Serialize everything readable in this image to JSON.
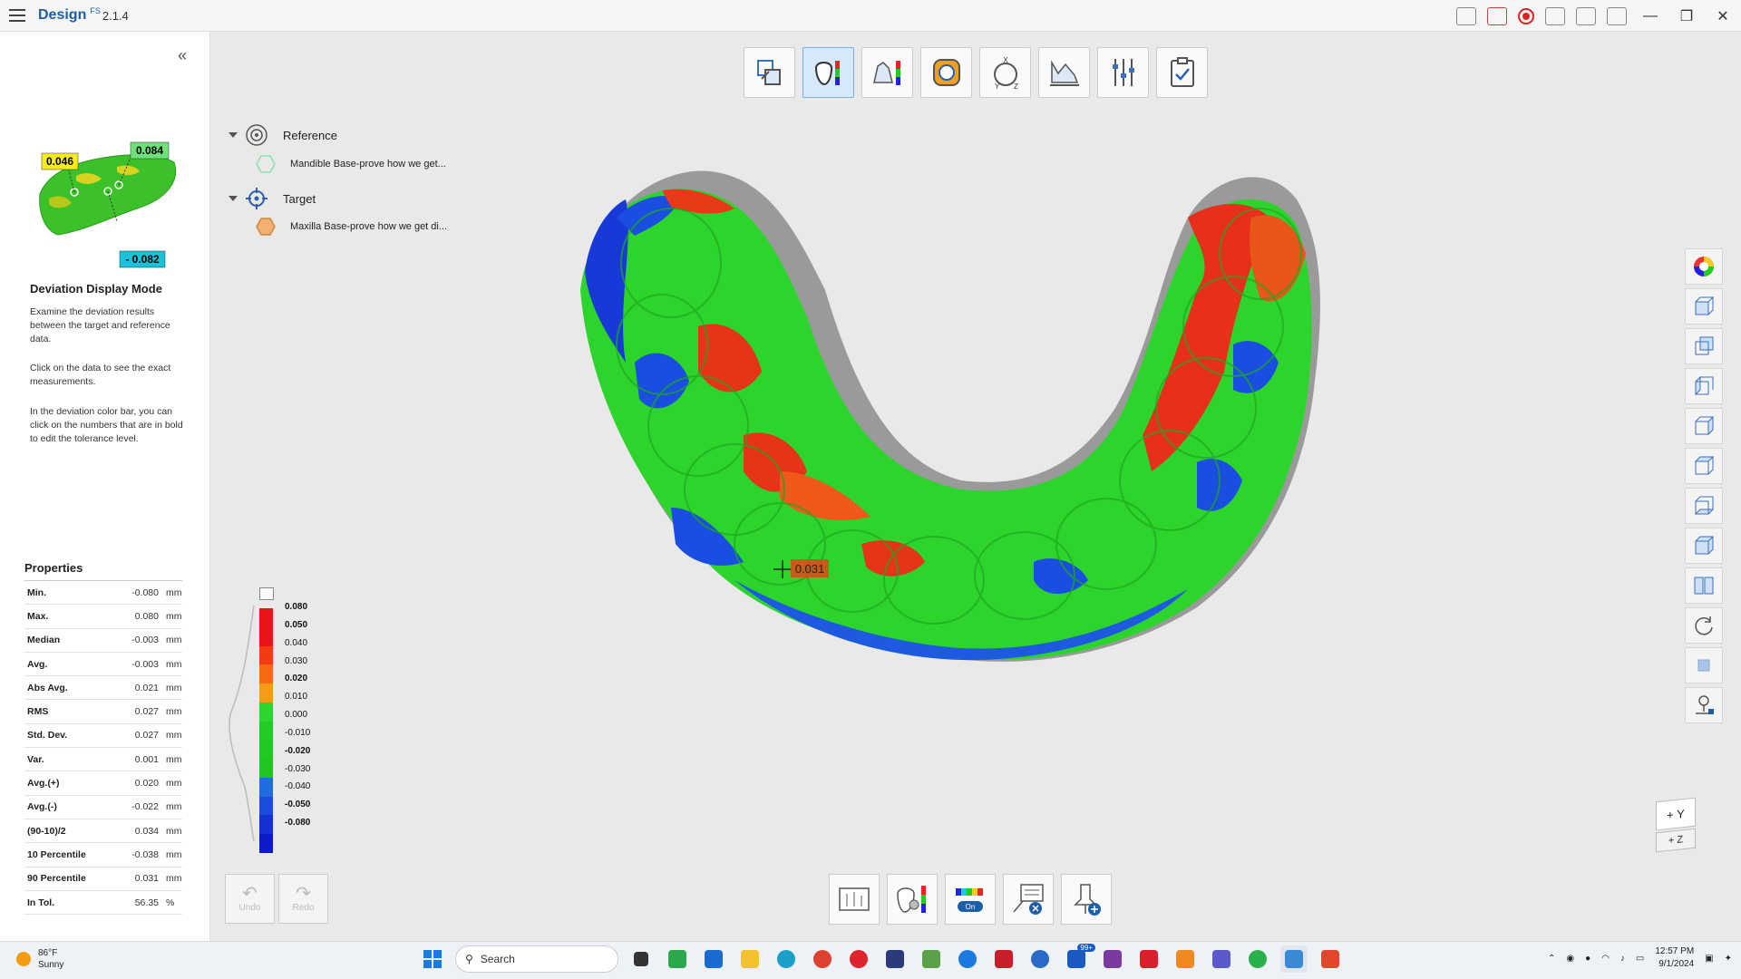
{
  "app": {
    "name": "Design",
    "superscript": "FS",
    "version": "2.1.4"
  },
  "sidebar": {
    "thumbnail_labels": {
      "top_left": "0.046",
      "top_right": "0.084",
      "bottom": "- 0.082"
    },
    "mode_title": "Deviation Display Mode",
    "desc1": "Examine the deviation results between the target and reference data.",
    "desc2": "Click on the data to see the exact measurements.",
    "desc3": "In the deviation color bar, you can click on the numbers that are in bold to edit the tolerance level.",
    "properties_title": "Properties",
    "properties": [
      {
        "label": "Min.",
        "value": "-0.080",
        "unit": "mm"
      },
      {
        "label": "Max.",
        "value": "0.080",
        "unit": "mm"
      },
      {
        "label": "Median",
        "value": "-0.003",
        "unit": "mm"
      },
      {
        "label": "Avg.",
        "value": "-0.003",
        "unit": "mm"
      },
      {
        "label": "Abs Avg.",
        "value": "0.021",
        "unit": "mm"
      },
      {
        "label": "RMS",
        "value": "0.027",
        "unit": "mm"
      },
      {
        "label": "Std. Dev.",
        "value": "0.027",
        "unit": "mm"
      },
      {
        "label": "Var.",
        "value": "0.001",
        "unit": "mm"
      },
      {
        "label": "Avg.(+)",
        "value": "0.020",
        "unit": "mm"
      },
      {
        "label": "Avg.(-)",
        "value": "-0.022",
        "unit": "mm"
      },
      {
        "label": "(90-10)/2",
        "value": "0.034",
        "unit": "mm"
      },
      {
        "label": "10 Percentile",
        "value": "-0.038",
        "unit": "mm"
      },
      {
        "label": "90 Percentile",
        "value": "0.031",
        "unit": "mm"
      },
      {
        "label": "In Tol.",
        "value": "56.35",
        "unit": "%"
      }
    ]
  },
  "tree": {
    "reference_label": "Reference",
    "reference_item": "Mandible Base-prove how we get...",
    "target_label": "Target",
    "target_item": "Maxilla Base-prove how we get di..."
  },
  "colorbar": {
    "labels": [
      {
        "text": "0.080",
        "bold": true
      },
      {
        "text": "0.050",
        "bold": true
      },
      {
        "text": "0.040",
        "bold": false
      },
      {
        "text": "0.030",
        "bold": false
      },
      {
        "text": "0.020",
        "bold": true
      },
      {
        "text": "0.010",
        "bold": false
      },
      {
        "text": "0.000",
        "bold": false
      },
      {
        "text": "-0.010",
        "bold": false
      },
      {
        "text": "-0.020",
        "bold": true
      },
      {
        "text": "-0.030",
        "bold": false
      },
      {
        "text": "-0.040",
        "bold": false
      },
      {
        "text": "-0.050",
        "bold": true
      },
      {
        "text": "-0.080",
        "bold": true
      }
    ],
    "colors": [
      "#e8141a",
      "#e8141a",
      "#f03c10",
      "#f56a12",
      "#f79a1c",
      "#2dd62d",
      "#22cc22",
      "#22c822",
      "#22c422",
      "#1e6ee0",
      "#1a4ed8",
      "#1433cc",
      "#0c1cc4"
    ]
  },
  "measurement": {
    "value": "0.031"
  },
  "undo": {
    "undo_label": "Undo",
    "redo_label": "Redo"
  },
  "axis": {
    "top": "+ Y",
    "bottom": "+ Z"
  },
  "taskbar": {
    "temp": "86°F",
    "weather": "Sunny",
    "search_placeholder": "Search",
    "time": "12:57 PM",
    "date": "9/1/2024",
    "badge": "99+"
  },
  "colors": {
    "accent": "#1d5ea8",
    "active_tool": "#d6e8fb"
  }
}
